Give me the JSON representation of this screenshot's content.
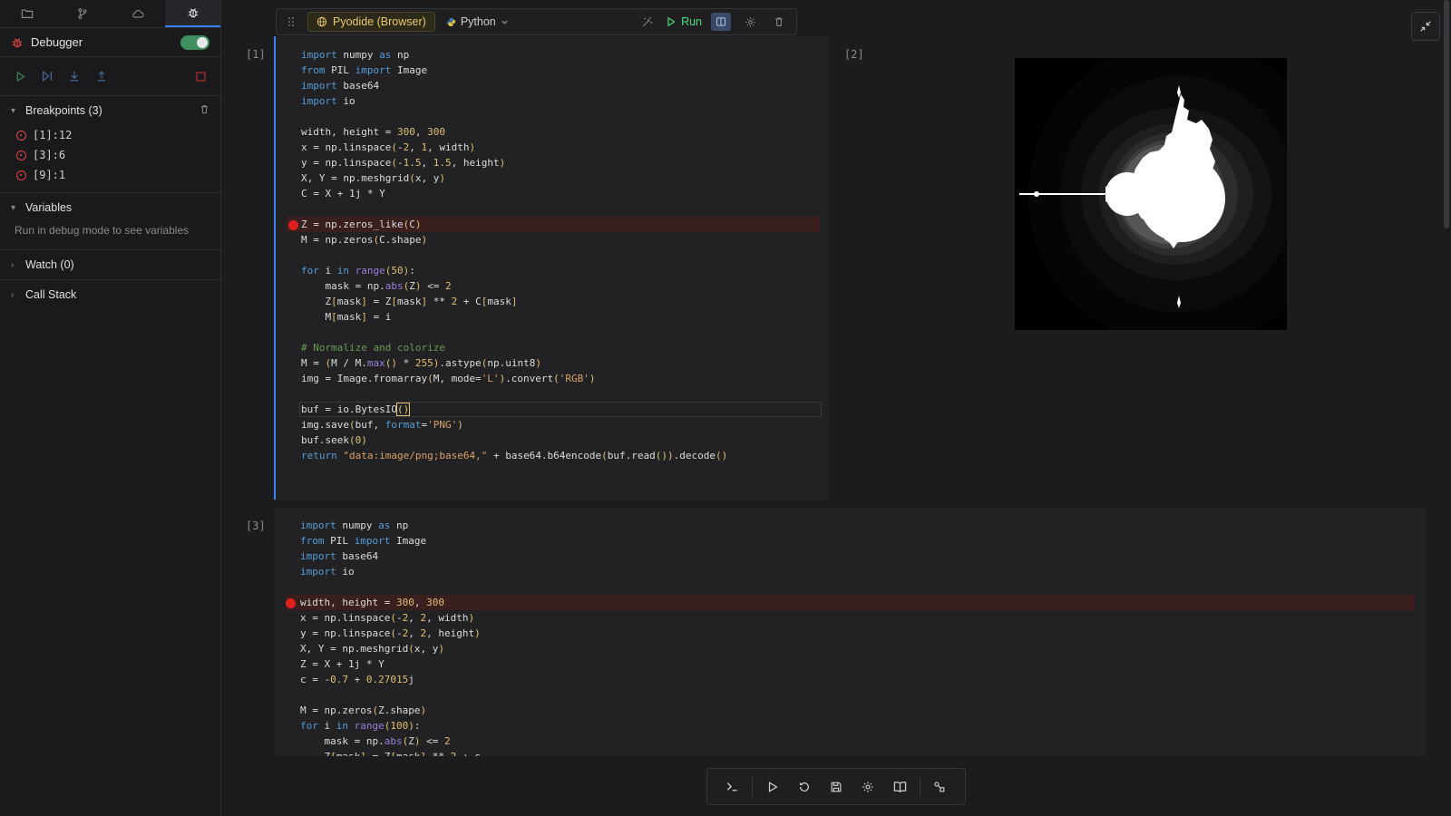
{
  "sidebar": {
    "tabs": [
      {
        "icon": "folder-icon"
      },
      {
        "icon": "git-branch-icon"
      },
      {
        "icon": "cloud-icon"
      },
      {
        "icon": "bug-icon",
        "active": true
      }
    ],
    "debugger": {
      "title": "Debugger",
      "enabled": true
    },
    "breakpoints": {
      "title": "Breakpoints (3)",
      "items": [
        "[1]:12",
        "[3]:6",
        "[9]:1"
      ]
    },
    "variables": {
      "title": "Variables",
      "message": "Run in debug mode to see variables"
    },
    "watch": {
      "title": "Watch (0)"
    },
    "call_stack": {
      "title": "Call Stack"
    }
  },
  "toolbar": {
    "runtime": "Pyodide (Browser)",
    "language": "Python",
    "run_label": "Run"
  },
  "cells": [
    {
      "label": "[1]",
      "breakpoint_line": 12,
      "output_label": "[2]"
    },
    {
      "label": "[3]",
      "breakpoint_line": 6
    }
  ],
  "colors": {
    "accent": "#3b82f6",
    "run": "#4ade80",
    "breakpoint": "#e02020",
    "runtime_chip": "#e8c96a"
  }
}
